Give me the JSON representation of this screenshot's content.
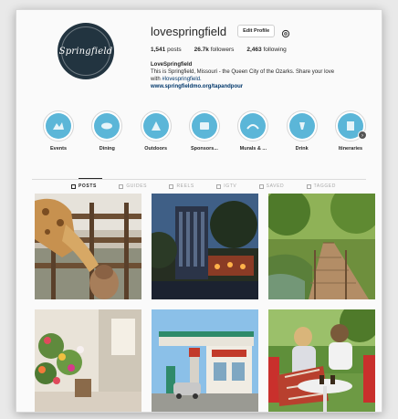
{
  "profile": {
    "avatar_text": "Springfield",
    "username": "lovespringfield",
    "edit_profile_label": "Edit Profile",
    "stats": {
      "posts": "1,541",
      "posts_label": "posts",
      "followers": "26.7k",
      "followers_label": "followers",
      "following": "2,463",
      "following_label": "following"
    },
    "bio_name": "LoveSpringfield",
    "bio_line1": "This is Springfield, Missouri - the Queen City of the Ozarks. Share your love",
    "bio_line2_prefix": "with",
    "bio_hashtag": "#lovespringfield.",
    "bio_link": "www.springfieldmo.org/tapandpour"
  },
  "highlights": [
    {
      "label": "Events"
    },
    {
      "label": "Dining"
    },
    {
      "label": "Outdoors"
    },
    {
      "label": "Sponsors..."
    },
    {
      "label": "Murals & ..."
    },
    {
      "label": "Drink"
    },
    {
      "label": "Itineraries"
    }
  ],
  "tabs": [
    {
      "label": "POSTS",
      "active": true
    },
    {
      "label": "GUIDES"
    },
    {
      "label": "REELS"
    },
    {
      "label": "IGTV"
    },
    {
      "label": "SAVED"
    },
    {
      "label": "TAGGED"
    }
  ],
  "colors": {
    "highlight_fill": "#5bb6d8",
    "link": "#00376b",
    "avatar_bg": "#223440"
  },
  "icons": {
    "settings": "gear-icon",
    "highlight_more": "chevron-right-icon"
  },
  "highlight_badge": "›"
}
